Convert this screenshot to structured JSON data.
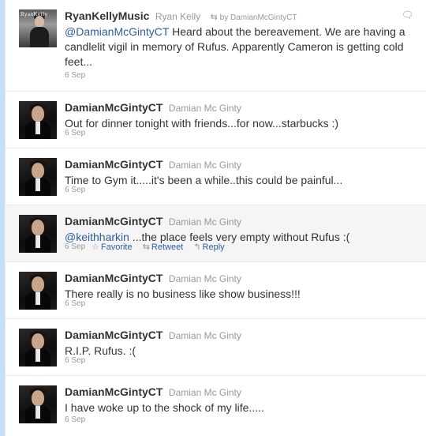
{
  "tweets": [
    {
      "screen_name": "RyanKellyMusic",
      "full_name": "Ryan Kelly",
      "retweeted_by": "by DamianMcGintyCT",
      "mention": "@DamianMcGintyCT",
      "text": " Heard about the bereavement. We are having a candlelit vigil in memory of Rufus. Apparently Cameron is getting cold feet...",
      "time": "6 Sep"
    },
    {
      "screen_name": "DamianMcGintyCT",
      "full_name": "Damian Mc Ginty",
      "text": "Out for dinner tonight with friends...for now...starbucks :)",
      "time": "6 Sep"
    },
    {
      "screen_name": "DamianMcGintyCT",
      "full_name": "Damian Mc Ginty",
      "text": "Time to Gym it.....it's been a while..this could be painful...",
      "time": "6 Sep"
    },
    {
      "screen_name": "DamianMcGintyCT",
      "full_name": "Damian Mc Ginty",
      "mention": "@keithharkin",
      "text": " ...the place feels very empty without Rufus :(",
      "time": "6 Sep",
      "actions": {
        "favorite": "Favorite",
        "retweet": "Retweet",
        "reply": "Reply"
      }
    },
    {
      "screen_name": "DamianMcGintyCT",
      "full_name": "Damian Mc Ginty",
      "text": "There really is no business like show business!!!",
      "time": "6 Sep"
    },
    {
      "screen_name": "DamianMcGintyCT",
      "full_name": "Damian Mc Ginty",
      "text": "R.I.P. Rufus. :(",
      "time": "6 Sep"
    },
    {
      "screen_name": "DamianMcGintyCT",
      "full_name": "Damian Mc Ginty",
      "text": "I have woke up to the shock of my life.....",
      "time": "6 Sep"
    }
  ],
  "icons": {
    "retweet": "retweet-icon",
    "favorite": "star-icon",
    "reply": "reply-arrow-icon",
    "corner_reply": "speech-bubble-icon"
  },
  "colors": {
    "link": "#2b5f9e",
    "meta": "#999999",
    "text": "#333333",
    "highlight_row": "#f5f5f5"
  }
}
